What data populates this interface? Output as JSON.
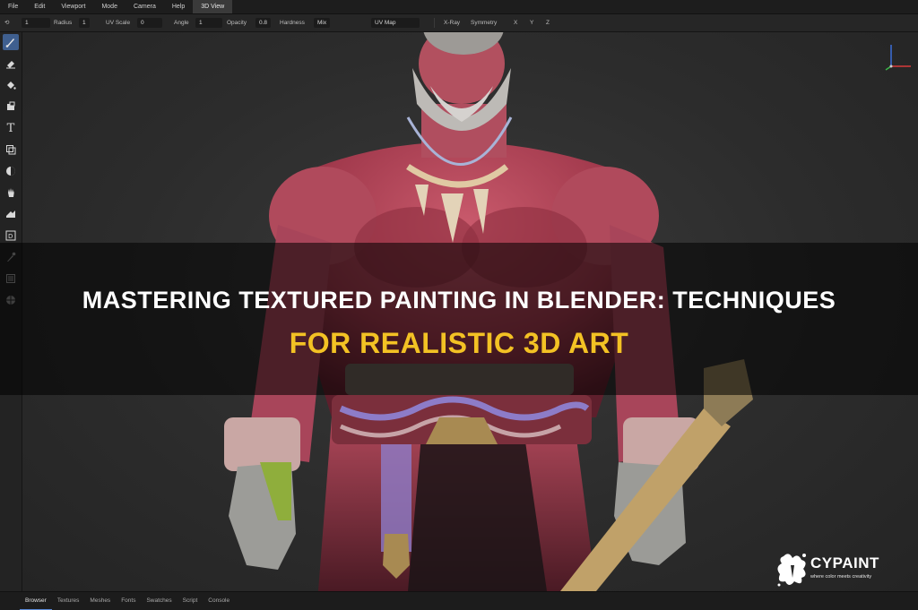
{
  "menubar": {
    "items": [
      "File",
      "Edit",
      "Viewport",
      "Mode",
      "Camera",
      "Help",
      "3D View"
    ]
  },
  "options": {
    "first_value": "1",
    "radius_label": "Radius",
    "radius_value": "1",
    "uvscale_label": "UV Scale",
    "uvscale_value": "0",
    "angle_label": "Angle",
    "angle_value": "1",
    "opacity_label": "Opacity",
    "opacity_value": "0.8",
    "hardness_label": "Hardness",
    "mix_label": "Mix",
    "uvmap_label": "UV Map",
    "xray_label": "X-Ray",
    "symmetry_label": "Symmetry",
    "x_label": "X",
    "y_label": "Y",
    "z_label": "Z"
  },
  "toolbar": {
    "icons": [
      "brush-icon",
      "eraser-icon",
      "fill-bucket-icon",
      "stamp-icon",
      "text-tool-icon",
      "clone-icon",
      "blur-icon",
      "smudge-hand-icon",
      "move-icon",
      "id-select-icon",
      "eyedropper-icon",
      "layers-icon",
      "sphere-icon"
    ],
    "active_index": 0
  },
  "bottom_tabs": [
    "Browser",
    "Textures",
    "Meshes",
    "Fonts",
    "Swatches",
    "Script",
    "Console"
  ],
  "banner": {
    "line1": "MASTERING TEXTURED PAINTING IN BLENDER: TECHNIQUES",
    "line2": "FOR REALISTIC 3D ART"
  },
  "logo": {
    "name": "CYPAINT",
    "tagline": "where color meets creativity"
  },
  "colors": {
    "accent_title": "#f3c224",
    "active_tool": "#3f5f8f",
    "character_skin": "#b8475a"
  }
}
